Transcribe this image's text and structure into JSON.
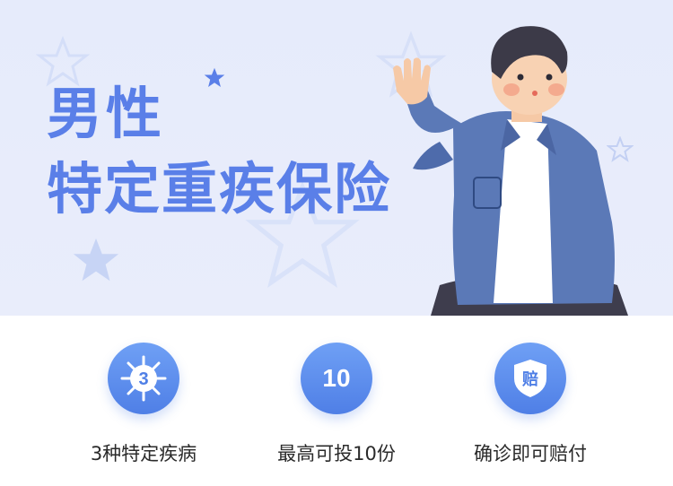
{
  "hero": {
    "title_line1": "男性",
    "title_line2": "特定重疾保险",
    "colors": {
      "background": "#e7ecfb",
      "title": "#5a7fe8",
      "star": "#cdd8f6"
    }
  },
  "features": [
    {
      "icon": "virus-3-icon",
      "icon_text": "3",
      "label": "3种特定疾病"
    },
    {
      "icon": "number-10-icon",
      "icon_text": "10",
      "label": "最高可投10份"
    },
    {
      "icon": "shield-compensation-icon",
      "icon_text": "赔",
      "label": "确诊即可赔付"
    }
  ]
}
